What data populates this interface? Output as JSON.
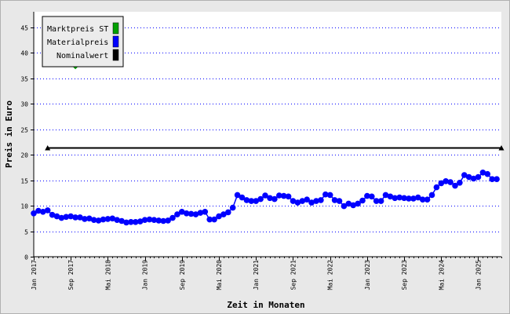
{
  "chart_data": {
    "type": "line",
    "xlabel": "Zeit in Monaten",
    "ylabel": "Preis in Euro",
    "ylim": [
      0,
      48
    ],
    "yticks": [
      0,
      5,
      10,
      15,
      20,
      25,
      30,
      35,
      40,
      45
    ],
    "xlim": [
      "2017-01",
      "2025-06"
    ],
    "xticks": [
      {
        "date": "2017-01",
        "label": "Jan 2017"
      },
      {
        "date": "2017-09",
        "label": "Sep 2017"
      },
      {
        "date": "2018-05",
        "label": "Mai 2018"
      },
      {
        "date": "2019-01",
        "label": "Jan 2019"
      },
      {
        "date": "2019-09",
        "label": "Sep 2019"
      },
      {
        "date": "2020-05",
        "label": "Mai 2020"
      },
      {
        "date": "2021-01",
        "label": "Jan 2021"
      },
      {
        "date": "2021-09",
        "label": "Sep 2021"
      },
      {
        "date": "2022-05",
        "label": "Mai 2022"
      },
      {
        "date": "2023-01",
        "label": "Jan 2023"
      },
      {
        "date": "2023-09",
        "label": "Sep 2023"
      },
      {
        "date": "2024-05",
        "label": "Mai 2024"
      },
      {
        "date": "2025-01",
        "label": "Jan 2025"
      }
    ],
    "grid": "horizontal dotted",
    "legend_placement": "top-left",
    "series": [
      {
        "name": "Marktpreis ST",
        "color": "#00a000",
        "style": "markers",
        "points": [
          {
            "date": "2017-10",
            "value": 37.2
          }
        ]
      },
      {
        "name": "Materialpreis",
        "color": "#0000ff",
        "style": "line-markers",
        "points": [
          {
            "date": "2017-01",
            "value": 8.5
          },
          {
            "date": "2017-02",
            "value": 9.0
          },
          {
            "date": "2017-03",
            "value": 8.8
          },
          {
            "date": "2017-04",
            "value": 9.1
          },
          {
            "date": "2017-05",
            "value": 8.2
          },
          {
            "date": "2017-06",
            "value": 7.9
          },
          {
            "date": "2017-07",
            "value": 7.6
          },
          {
            "date": "2017-08",
            "value": 7.8
          },
          {
            "date": "2017-09",
            "value": 7.9
          },
          {
            "date": "2017-10",
            "value": 7.7
          },
          {
            "date": "2017-11",
            "value": 7.7
          },
          {
            "date": "2017-12",
            "value": 7.4
          },
          {
            "date": "2018-01",
            "value": 7.5
          },
          {
            "date": "2018-02",
            "value": 7.2
          },
          {
            "date": "2018-03",
            "value": 7.1
          },
          {
            "date": "2018-04",
            "value": 7.3
          },
          {
            "date": "2018-05",
            "value": 7.4
          },
          {
            "date": "2018-06",
            "value": 7.5
          },
          {
            "date": "2018-07",
            "value": 7.2
          },
          {
            "date": "2018-08",
            "value": 7.0
          },
          {
            "date": "2018-09",
            "value": 6.7
          },
          {
            "date": "2018-10",
            "value": 6.8
          },
          {
            "date": "2018-11",
            "value": 6.8
          },
          {
            "date": "2018-12",
            "value": 6.9
          },
          {
            "date": "2019-01",
            "value": 7.2
          },
          {
            "date": "2019-02",
            "value": 7.3
          },
          {
            "date": "2019-03",
            "value": 7.2
          },
          {
            "date": "2019-04",
            "value": 7.1
          },
          {
            "date": "2019-05",
            "value": 7.0
          },
          {
            "date": "2019-06",
            "value": 7.1
          },
          {
            "date": "2019-07",
            "value": 7.6
          },
          {
            "date": "2019-08",
            "value": 8.3
          },
          {
            "date": "2019-09",
            "value": 8.8
          },
          {
            "date": "2019-10",
            "value": 8.5
          },
          {
            "date": "2019-11",
            "value": 8.4
          },
          {
            "date": "2019-12",
            "value": 8.3
          },
          {
            "date": "2020-01",
            "value": 8.6
          },
          {
            "date": "2020-02",
            "value": 8.8
          },
          {
            "date": "2020-03",
            "value": 7.3
          },
          {
            "date": "2020-04",
            "value": 7.3
          },
          {
            "date": "2020-05",
            "value": 7.9
          },
          {
            "date": "2020-06",
            "value": 8.3
          },
          {
            "date": "2020-07",
            "value": 8.7
          },
          {
            "date": "2020-08",
            "value": 9.6
          },
          {
            "date": "2020-09",
            "value": 12.1
          },
          {
            "date": "2020-10",
            "value": 11.6
          },
          {
            "date": "2020-11",
            "value": 11.1
          },
          {
            "date": "2020-12",
            "value": 10.9
          },
          {
            "date": "2021-01",
            "value": 10.9
          },
          {
            "date": "2021-02",
            "value": 11.3
          },
          {
            "date": "2021-03",
            "value": 12.0
          },
          {
            "date": "2021-04",
            "value": 11.5
          },
          {
            "date": "2021-05",
            "value": 11.3
          },
          {
            "date": "2021-06",
            "value": 12.0
          },
          {
            "date": "2021-07",
            "value": 11.9
          },
          {
            "date": "2021-08",
            "value": 11.8
          },
          {
            "date": "2021-09",
            "value": 10.9
          },
          {
            "date": "2021-10",
            "value": 10.6
          },
          {
            "date": "2021-11",
            "value": 10.9
          },
          {
            "date": "2021-12",
            "value": 11.2
          },
          {
            "date": "2022-01",
            "value": 10.6
          },
          {
            "date": "2022-02",
            "value": 10.9
          },
          {
            "date": "2022-03",
            "value": 11.1
          },
          {
            "date": "2022-04",
            "value": 12.2
          },
          {
            "date": "2022-05",
            "value": 12.1
          },
          {
            "date": "2022-06",
            "value": 11.1
          },
          {
            "date": "2022-07",
            "value": 10.9
          },
          {
            "date": "2022-08",
            "value": 9.9
          },
          {
            "date": "2022-09",
            "value": 10.4
          },
          {
            "date": "2022-10",
            "value": 10.1
          },
          {
            "date": "2022-11",
            "value": 10.4
          },
          {
            "date": "2022-12",
            "value": 11.0
          },
          {
            "date": "2023-01",
            "value": 11.9
          },
          {
            "date": "2023-02",
            "value": 11.8
          },
          {
            "date": "2023-03",
            "value": 10.9
          },
          {
            "date": "2023-04",
            "value": 10.9
          },
          {
            "date": "2023-05",
            "value": 12.1
          },
          {
            "date": "2023-06",
            "value": 11.8
          },
          {
            "date": "2023-07",
            "value": 11.5
          },
          {
            "date": "2023-08",
            "value": 11.6
          },
          {
            "date": "2023-09",
            "value": 11.5
          },
          {
            "date": "2023-10",
            "value": 11.4
          },
          {
            "date": "2023-11",
            "value": 11.4
          },
          {
            "date": "2023-12",
            "value": 11.6
          },
          {
            "date": "2024-01",
            "value": 11.2
          },
          {
            "date": "2024-02",
            "value": 11.2
          },
          {
            "date": "2024-03",
            "value": 12.1
          },
          {
            "date": "2024-04",
            "value": 13.6
          },
          {
            "date": "2024-05",
            "value": 14.4
          },
          {
            "date": "2024-06",
            "value": 14.8
          },
          {
            "date": "2024-07",
            "value": 14.6
          },
          {
            "date": "2024-08",
            "value": 13.9
          },
          {
            "date": "2024-09",
            "value": 14.5
          },
          {
            "date": "2024-10",
            "value": 16.0
          },
          {
            "date": "2024-11",
            "value": 15.6
          },
          {
            "date": "2024-12",
            "value": 15.3
          },
          {
            "date": "2025-01",
            "value": 15.6
          },
          {
            "date": "2025-02",
            "value": 16.5
          },
          {
            "date": "2025-03",
            "value": 16.2
          },
          {
            "date": "2025-04",
            "value": 15.2
          },
          {
            "date": "2025-05",
            "value": 15.2
          }
        ]
      },
      {
        "name": "Nominalwert",
        "color": "#000000",
        "style": "line-triangles",
        "points": [
          {
            "date": "2017-04",
            "value": 21.3
          },
          {
            "date": "2025-06",
            "value": 21.3
          }
        ]
      }
    ]
  }
}
